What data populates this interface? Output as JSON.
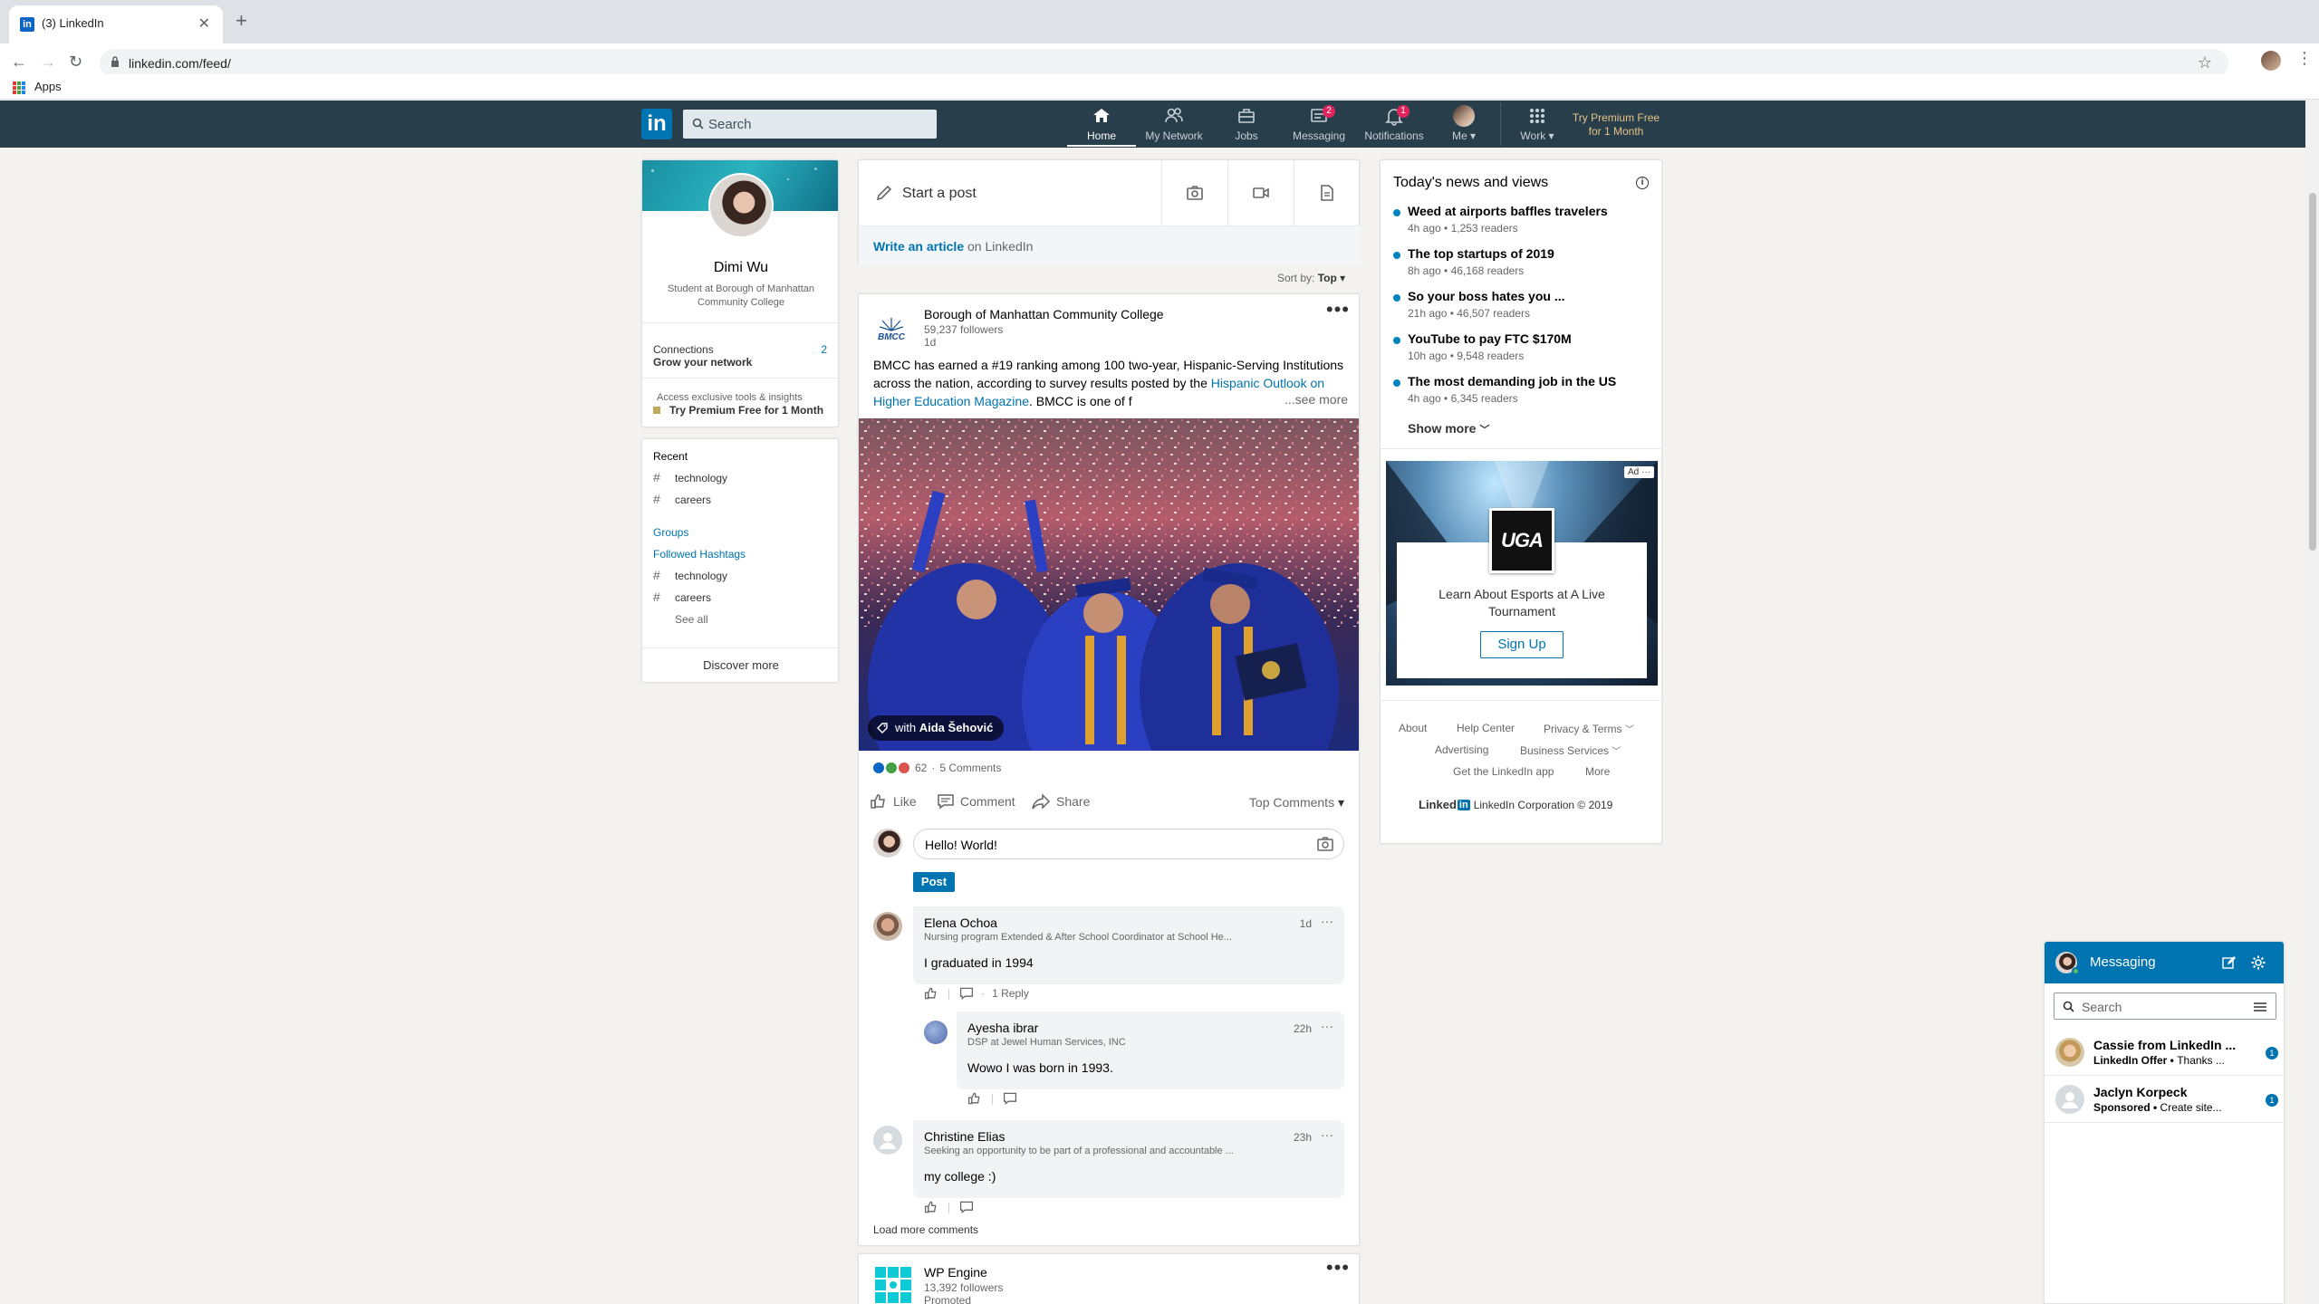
{
  "browser": {
    "tab_title": "(3) LinkedIn",
    "url": "linkedin.com/feed/",
    "bookmark_apps": "Apps"
  },
  "nav": {
    "search_placeholder": "Search",
    "items": [
      {
        "label": "Home"
      },
      {
        "label": "My Network"
      },
      {
        "label": "Jobs"
      },
      {
        "label": "Messaging",
        "badge": "2"
      },
      {
        "label": "Notifications",
        "badge": "1"
      },
      {
        "label": "Me ▾"
      },
      {
        "label": "Work ▾"
      }
    ],
    "premium": "Try Premium Free for 1 Month",
    "colors": {
      "bar": "#283e4a",
      "accent": "#0073b1",
      "premium": "#e7c48a",
      "badge": "#e0245e"
    }
  },
  "profile": {
    "name": "Dimi Wu",
    "headline": "Student at Borough of Manhattan Community College",
    "connections_label": "Connections",
    "connections_count": "2",
    "grow": "Grow your network",
    "exclusive": "Access exclusive tools & insights",
    "premium": "Try Premium Free for 1 Month"
  },
  "sidebar": {
    "recent_title": "Recent",
    "recent": [
      "technology",
      "careers"
    ],
    "groups": "Groups",
    "followed": "Followed Hashtags",
    "hashtags": [
      "technology",
      "careers"
    ],
    "see_all": "See all",
    "discover": "Discover more"
  },
  "share": {
    "start_post": "Start a post",
    "write_article": "Write an article",
    "on_linkedin": " on LinkedIn",
    "sort_label": "Sort by: ",
    "sort_value": "Top"
  },
  "post": {
    "author": "Borough of Manhattan Community College",
    "followers": "59,237 followers",
    "age": "1d",
    "logo_text": "BMCC",
    "text_1": "BMCC has earned a #19 ranking among 100 two-year, Hispanic-Serving Institutions across the nation, according to survey results posted by the ",
    "text_link": "Hispanic Outlook on Higher Education Magazine",
    "text_2": ". BMCC is one of f",
    "see_more": "...see more",
    "with_tag": "with ",
    "with_name": "Aida Šehović",
    "reactions_count": "62",
    "comments_count": "5 Comments",
    "actions": [
      "Like",
      "Comment",
      "Share"
    ],
    "top_comments": "Top Comments",
    "comment_input": "Hello! World!",
    "post_button": "Post",
    "load_more": "Load more comments"
  },
  "comments": [
    {
      "name": "Elena Ochoa",
      "headline": "Nursing program Extended & After School Coordinator at School He...",
      "time": "1d",
      "text": "I graduated in 1994",
      "replies": "1 Reply"
    },
    {
      "name": "Ayesha ibrar",
      "headline": "DSP at Jewel Human Services, INC",
      "time": "22h",
      "text": "Wowo I was born in 1993."
    },
    {
      "name": "Christine Elias",
      "headline": "Seeking an opportunity to be part of a professional and accountable ...",
      "time": "23h",
      "text": "my college :)"
    }
  ],
  "next_post": {
    "author": "WP Engine",
    "followers": "13,392 followers",
    "promoted": "Promoted"
  },
  "news": {
    "title": "Today's news and views",
    "items": [
      {
        "headline": "Weed at airports baffles travelers",
        "meta": "4h ago • 1,253 readers"
      },
      {
        "headline": "The top startups of 2019",
        "meta": "8h ago • 46,168 readers"
      },
      {
        "headline": "So your boss hates you ...",
        "meta": "21h ago • 46,507 readers"
      },
      {
        "headline": "YouTube to pay FTC $170M",
        "meta": "10h ago • 9,548 readers"
      },
      {
        "headline": "The most demanding job in the US",
        "meta": "4h ago • 6,345 readers"
      }
    ],
    "show_more": "Show more"
  },
  "ad": {
    "tag": "Ad",
    "logo_text": "UGA",
    "text": "Learn About Esports at A Live Tournament",
    "cta": "Sign Up"
  },
  "footer": {
    "about": "About",
    "help": "Help Center",
    "privacy": "Privacy & Terms",
    "advertising": "Advertising",
    "business": "Business Services",
    "app": "Get the LinkedIn app",
    "more": "More",
    "brand": "Linked",
    "copyright": "LinkedIn Corporation © 2019"
  },
  "messaging": {
    "title": "Messaging",
    "search_placeholder": "Search",
    "threads": [
      {
        "name": "Cassie from LinkedIn ...",
        "preview_bold": "LinkedIn Offer • ",
        "preview": "Thanks ...",
        "unread": "1"
      },
      {
        "name": "Jaclyn Korpeck",
        "preview_bold": "Sponsored • ",
        "preview": "Create site...",
        "unread": "1"
      }
    ]
  }
}
